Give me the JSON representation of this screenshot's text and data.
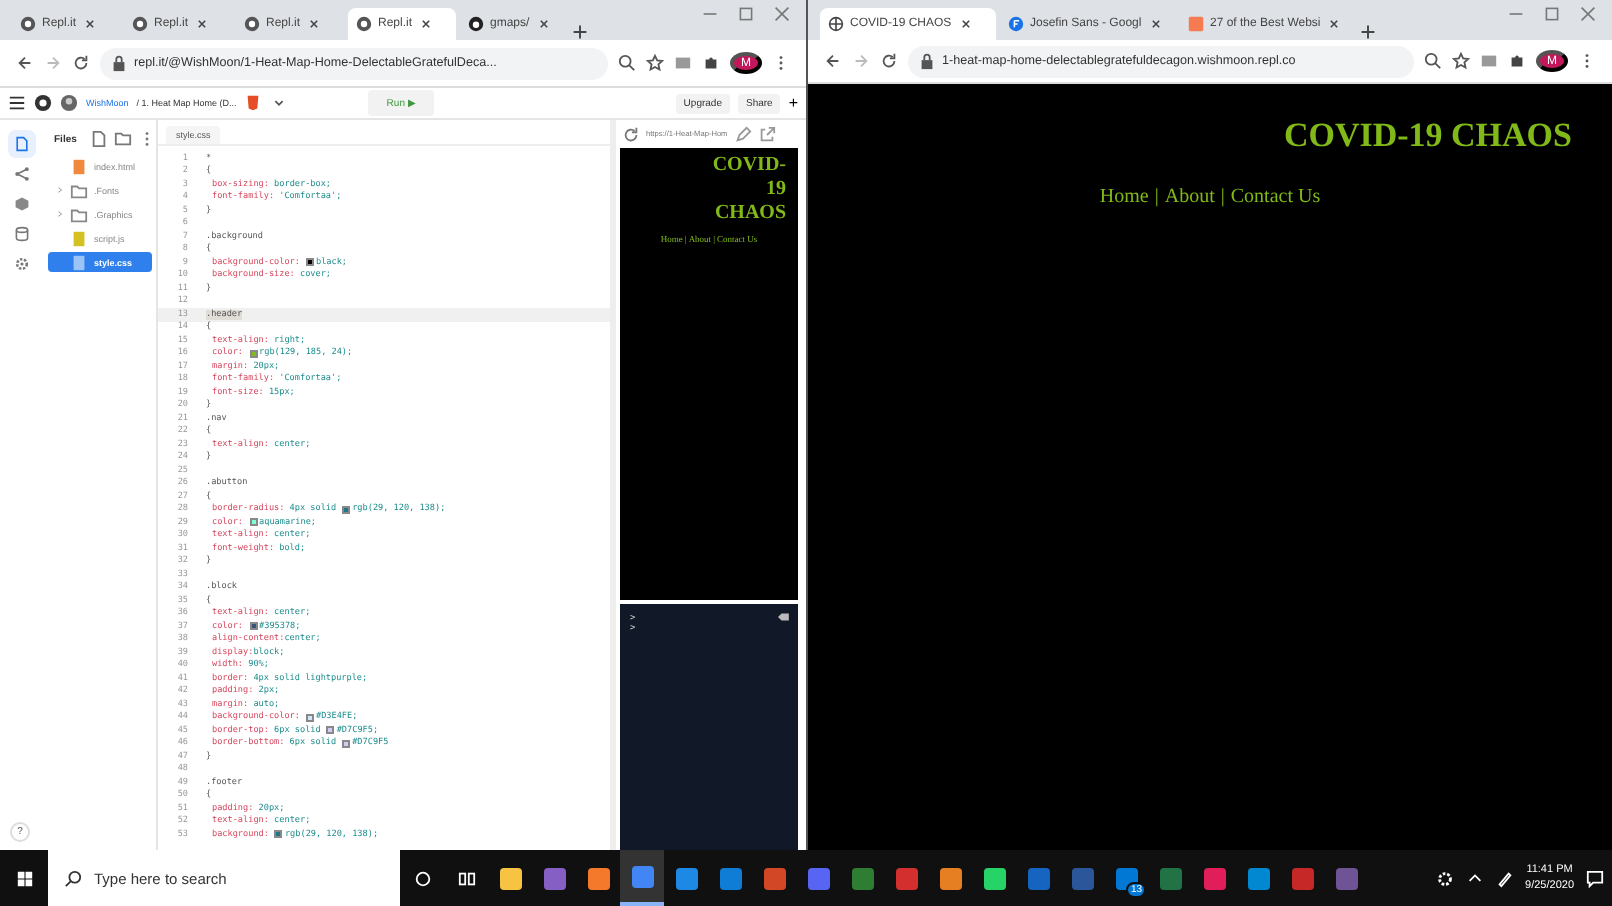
{
  "left_window": {
    "tabs": [
      {
        "label": "Repl.it",
        "selected": false,
        "kind": "repl"
      },
      {
        "label": "Repl.it",
        "selected": false,
        "kind": "repl"
      },
      {
        "label": "Repl.it",
        "selected": false,
        "kind": "repl"
      },
      {
        "label": "Repl.it",
        "selected": true,
        "kind": "repl"
      },
      {
        "label": "gmaps/",
        "selected": false,
        "kind": "github"
      }
    ],
    "address": "repl.it/@WishMoon/1-Heat-Map-Home-DelectableGratefulDeca...",
    "profile": "M",
    "repl": {
      "user": "WishMoon",
      "project": "/ 1. Heat Map Home (D...",
      "run": "Run ▶",
      "upgrade": "Upgrade",
      "share": "Share",
      "add": "+"
    },
    "files": {
      "title": "Files",
      "items": [
        {
          "name": "index.html",
          "kind": "html",
          "selected": false
        },
        {
          "name": ".Fonts",
          "kind": "folder",
          "selected": false
        },
        {
          "name": ".Graphics",
          "kind": "folder",
          "selected": false
        },
        {
          "name": "script.js",
          "kind": "js",
          "selected": false
        },
        {
          "name": "style.css",
          "kind": "css",
          "selected": true
        }
      ]
    },
    "editor": {
      "tab": "style.css",
      "lines": [
        {
          "number": "1",
          "kind": "selector",
          "text": "*",
          "active": false
        },
        {
          "number": "2",
          "kind": "brace",
          "text": "{",
          "active": false
        },
        {
          "number": "3",
          "kind": "decl",
          "property": "box-sizing:",
          "value": " border-box;",
          "active": false
        },
        {
          "number": "4",
          "kind": "decl",
          "property": "font-family:",
          "value": " 'Comfortaa';",
          "active": false
        },
        {
          "number": "5",
          "kind": "brace",
          "text": "}",
          "active": false
        },
        {
          "number": "6",
          "kind": "blank",
          "active": false
        },
        {
          "number": "7",
          "kind": "selector",
          "text": ".background",
          "active": false
        },
        {
          "number": "8",
          "kind": "brace",
          "text": "{",
          "active": false
        },
        {
          "number": "9",
          "kind": "decl",
          "property": "background-color:",
          "color": "#000000",
          "value": "black;",
          "active": false
        },
        {
          "number": "10",
          "kind": "decl",
          "property": "background-size:",
          "value": " cover;",
          "active": false
        },
        {
          "number": "11",
          "kind": "brace",
          "text": "}",
          "active": false
        },
        {
          "number": "12",
          "kind": "blank",
          "active": false
        },
        {
          "number": "13",
          "kind": "selector",
          "text": ".header",
          "active": true
        },
        {
          "number": "14",
          "kind": "brace",
          "text": "{",
          "active": false
        },
        {
          "number": "15",
          "kind": "decl",
          "property": "text-align:",
          "value": " right;",
          "active": false
        },
        {
          "number": "16",
          "kind": "decl",
          "property": "color:",
          "color": "#81b918",
          "value": "rgb(129, 185, 24);",
          "active": false
        },
        {
          "number": "17",
          "kind": "decl",
          "property": "margin:",
          "value": " 20px;",
          "active": false
        },
        {
          "number": "18",
          "kind": "decl",
          "property": "font-family:",
          "value": " 'Comfortaa';",
          "active": false
        },
        {
          "number": "19",
          "kind": "decl",
          "property": "font-size:",
          "value": " 15px;",
          "active": false
        },
        {
          "number": "20",
          "kind": "brace",
          "text": "}",
          "active": false
        },
        {
          "number": "21",
          "kind": "selector",
          "text": ".nav",
          "active": false
        },
        {
          "number": "22",
          "kind": "brace",
          "text": "{",
          "active": false
        },
        {
          "number": "23",
          "kind": "decl",
          "property": "text-align:",
          "value": " center;",
          "active": false
        },
        {
          "number": "24",
          "kind": "brace",
          "text": "}",
          "active": false
        },
        {
          "number": "25",
          "kind": "blank",
          "active": false
        },
        {
          "number": "26",
          "kind": "selector",
          "text": ".abutton",
          "active": false
        },
        {
          "number": "27",
          "kind": "brace",
          "text": "{",
          "active": false
        },
        {
          "number": "28",
          "kind": "decl",
          "property": "border-radius:",
          "pre": " 4px solid",
          "color": "#1d788a",
          "value": "rgb(29, 120, 138);",
          "active": false
        },
        {
          "number": "29",
          "kind": "decl",
          "property": "color:",
          "color": "#7fffd4",
          "value": "aquamarine;",
          "active": false
        },
        {
          "number": "30",
          "kind": "decl",
          "property": "text-align:",
          "value": " center;",
          "active": false
        },
        {
          "number": "31",
          "kind": "decl",
          "property": "font-weight:",
          "value": " bold;",
          "active": false
        },
        {
          "number": "32",
          "kind": "brace",
          "text": "}",
          "active": false
        },
        {
          "number": "33",
          "kind": "blank",
          "active": false
        },
        {
          "number": "34",
          "kind": "selector",
          "text": ".block",
          "active": false
        },
        {
          "number": "35",
          "kind": "brace",
          "text": "{",
          "active": false
        },
        {
          "number": "36",
          "kind": "decl",
          "property": "text-align:",
          "value": " center;",
          "active": false
        },
        {
          "number": "37",
          "kind": "decl",
          "property": "color:",
          "color": "#395378",
          "value": "#395378;",
          "active": false
        },
        {
          "number": "38",
          "kind": "decl",
          "property": "align-content:",
          "value": "center;",
          "active": false
        },
        {
          "number": "39",
          "kind": "decl",
          "property": "display:",
          "value": "block;",
          "active": false
        },
        {
          "number": "40",
          "kind": "decl",
          "property": "width:",
          "value": " 90%;",
          "active": false
        },
        {
          "number": "41",
          "kind": "decl",
          "property": "border:",
          "value": " 4px solid lightpurple;",
          "active": false
        },
        {
          "number": "42",
          "kind": "decl",
          "property": "padding:",
          "value": " 2px;",
          "active": false
        },
        {
          "number": "43",
          "kind": "decl",
          "property": "margin:",
          "value": " auto;",
          "active": false
        },
        {
          "number": "44",
          "kind": "decl",
          "property": "background-color:",
          "color": "#d3e4fe",
          "value": "#D3E4FE;",
          "active": false
        },
        {
          "number": "45",
          "kind": "decl",
          "property": "border-top:",
          "pre": " 6px solid",
          "color": "#d7c9f5",
          "value": "#D7C9F5;",
          "active": false
        },
        {
          "number": "46",
          "kind": "decl",
          "property": "border-bottom:",
          "pre": " 6px solid",
          "color": "#d7c9f5",
          "value": "#D7C9F5",
          "active": false
        },
        {
          "number": "47",
          "kind": "brace",
          "text": "}",
          "active": false
        },
        {
          "number": "48",
          "kind": "blank",
          "active": false
        },
        {
          "number": "49",
          "kind": "selector",
          "text": ".footer",
          "active": false
        },
        {
          "number": "50",
          "kind": "brace",
          "text": "{",
          "active": false
        },
        {
          "number": "51",
          "kind": "decl",
          "property": "padding:",
          "value": " 20px;",
          "active": false
        },
        {
          "number": "52",
          "kind": "decl",
          "property": "text-align:",
          "value": " center;",
          "active": false
        },
        {
          "number": "53",
          "kind": "decl",
          "property": "background:",
          "color": "#1d788a",
          "value": "rgb(29, 120, 138);",
          "active": false
        }
      ]
    },
    "preview": {
      "url": "https://1-Heat-Map-Hom",
      "heading": "COVID-19 CHAOS",
      "nav": [
        "Home",
        "About",
        "Contact Us"
      ],
      "separator": "|"
    },
    "console": {
      "prompts": [
        ">",
        ">"
      ]
    },
    "help": "?"
  },
  "right_window": {
    "tabs": [
      {
        "label": "COVID-19 CHAOS",
        "selected": true,
        "kind": "globe"
      },
      {
        "label": "Josefin Sans - Googl",
        "selected": false,
        "kind": "fonts"
      },
      {
        "label": "27 of the Best Websi",
        "selected": false,
        "kind": "hubspot"
      }
    ],
    "address": "1-heat-map-home-delectablegratefuldecagon.wishmoon.repl.co",
    "profile": "M",
    "page": {
      "heading": "COVID-19 CHAOS",
      "nav": [
        "Home",
        "About",
        "Contact Us"
      ],
      "separator": "|"
    }
  },
  "taskbar": {
    "search_placeholder": "Type here to search",
    "apps": [
      {
        "color": "#f6c343",
        "running": false
      },
      {
        "color": "#865fc5",
        "running": false
      },
      {
        "color": "#f5792a",
        "running": false
      },
      {
        "color": "#4285f4",
        "running": true
      },
      {
        "color": "#1e88e5",
        "running": false
      },
      {
        "color": "#0f7cd6",
        "running": false
      },
      {
        "color": "#d24726",
        "running": false
      },
      {
        "color": "#5865f2",
        "running": false
      },
      {
        "color": "#2e7d32",
        "running": false
      },
      {
        "color": "#d32f2f",
        "running": false
      },
      {
        "color": "#e67e22",
        "running": false
      },
      {
        "color": "#25d366",
        "running": false
      },
      {
        "color": "#1565c0",
        "running": false
      },
      {
        "color": "#2b579a",
        "running": false
      },
      {
        "color": "#0078d4",
        "running": false,
        "badge": "13"
      },
      {
        "color": "#217346",
        "running": false
      },
      {
        "color": "#e01e5a",
        "running": false
      },
      {
        "color": "#0288d1",
        "running": false
      },
      {
        "color": "#c62828",
        "running": false
      },
      {
        "color": "#6e5494",
        "running": false
      }
    ],
    "time": "11:41 PM",
    "date": "9/25/2020"
  }
}
